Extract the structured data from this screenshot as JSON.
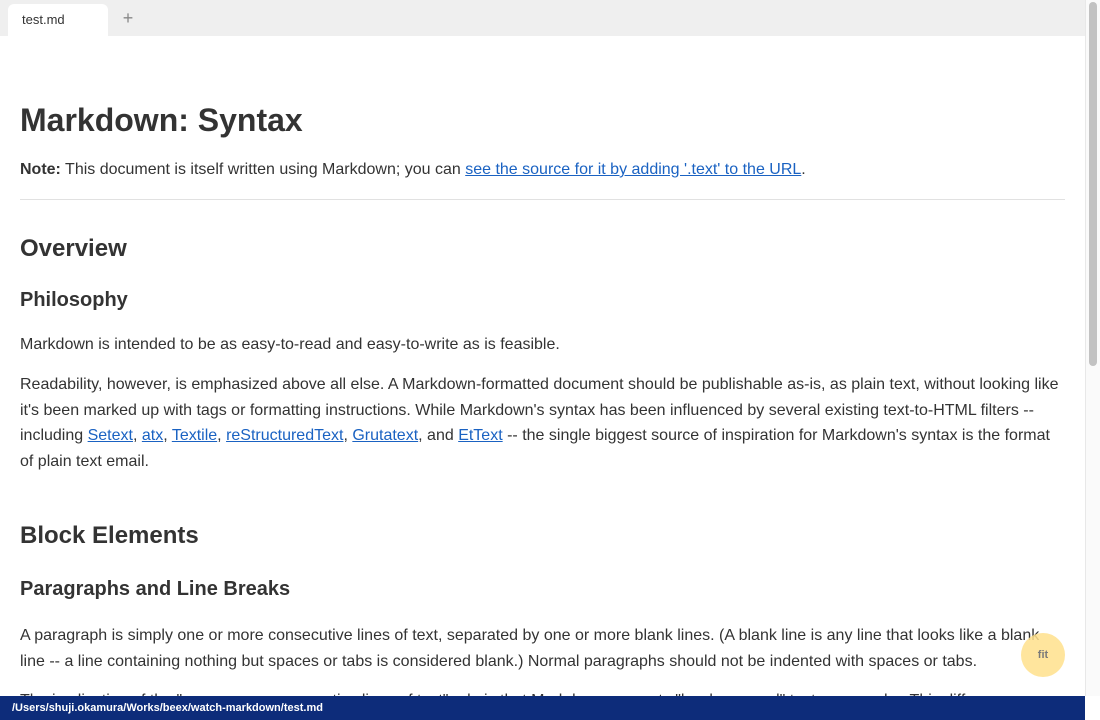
{
  "tab": {
    "title": "test.md",
    "add_label": "+"
  },
  "document": {
    "title": "Markdown: Syntax",
    "note": {
      "label": "Note:",
      "text_before": " This document is itself written using Markdown; you can ",
      "link": "see the source for it by adding '.text' to the URL",
      "text_after": "."
    },
    "overview_heading": "Overview",
    "philosophy_heading": "Philosophy",
    "intro_paragraph": "Markdown is intended to be as easy-to-read and easy-to-write as is feasible.",
    "readability": {
      "text_1": "Readability, however, is emphasized above all else. A Markdown-formatted document should be publishable as-is, as plain text, without looking like it's been marked up with tags or formatting instructions. While Markdown's syntax has been influenced by several existing text-to-HTML filters -- including ",
      "link_setext": "Setext",
      "sep_1": ", ",
      "link_atx": "atx",
      "sep_2": ", ",
      "link_textile": "Textile",
      "sep_3": ", ",
      "link_restructuredtext": "reStructuredText",
      "sep_4": ", ",
      "link_grutatext": "Grutatext",
      "sep_5": ", and ",
      "link_ettext": "EtText",
      "text_2": " -- the single biggest source of inspiration for Markdown's syntax is the format of plain text email."
    },
    "block_elements_heading": "Block Elements",
    "paragraphs_heading": "Paragraphs and Line Breaks",
    "paragraph_definition": "A paragraph is simply one or more consecutive lines of text, separated by one or more blank lines. (A blank line is any line that looks like a blank line -- a line containing nothing but spaces or tabs is considered blank.) Normal paragraphs should not be indented with spaces or tabs.",
    "implication_paragraph": "The implication of the \"one or more consecutive lines of text\" rule is that Markdown supports \"hard-wrapped\" text paragraphs. This differs"
  },
  "fit_button": {
    "label": "fit"
  },
  "status": {
    "file_path": "/Users/shuji.okamura/Works/beex/watch-markdown/test.md"
  },
  "colors": {
    "link": "#1a62c2",
    "status_bar": "#0d2c7a",
    "tab_bar": "#efefef",
    "fit_button": "#ffe08c"
  }
}
